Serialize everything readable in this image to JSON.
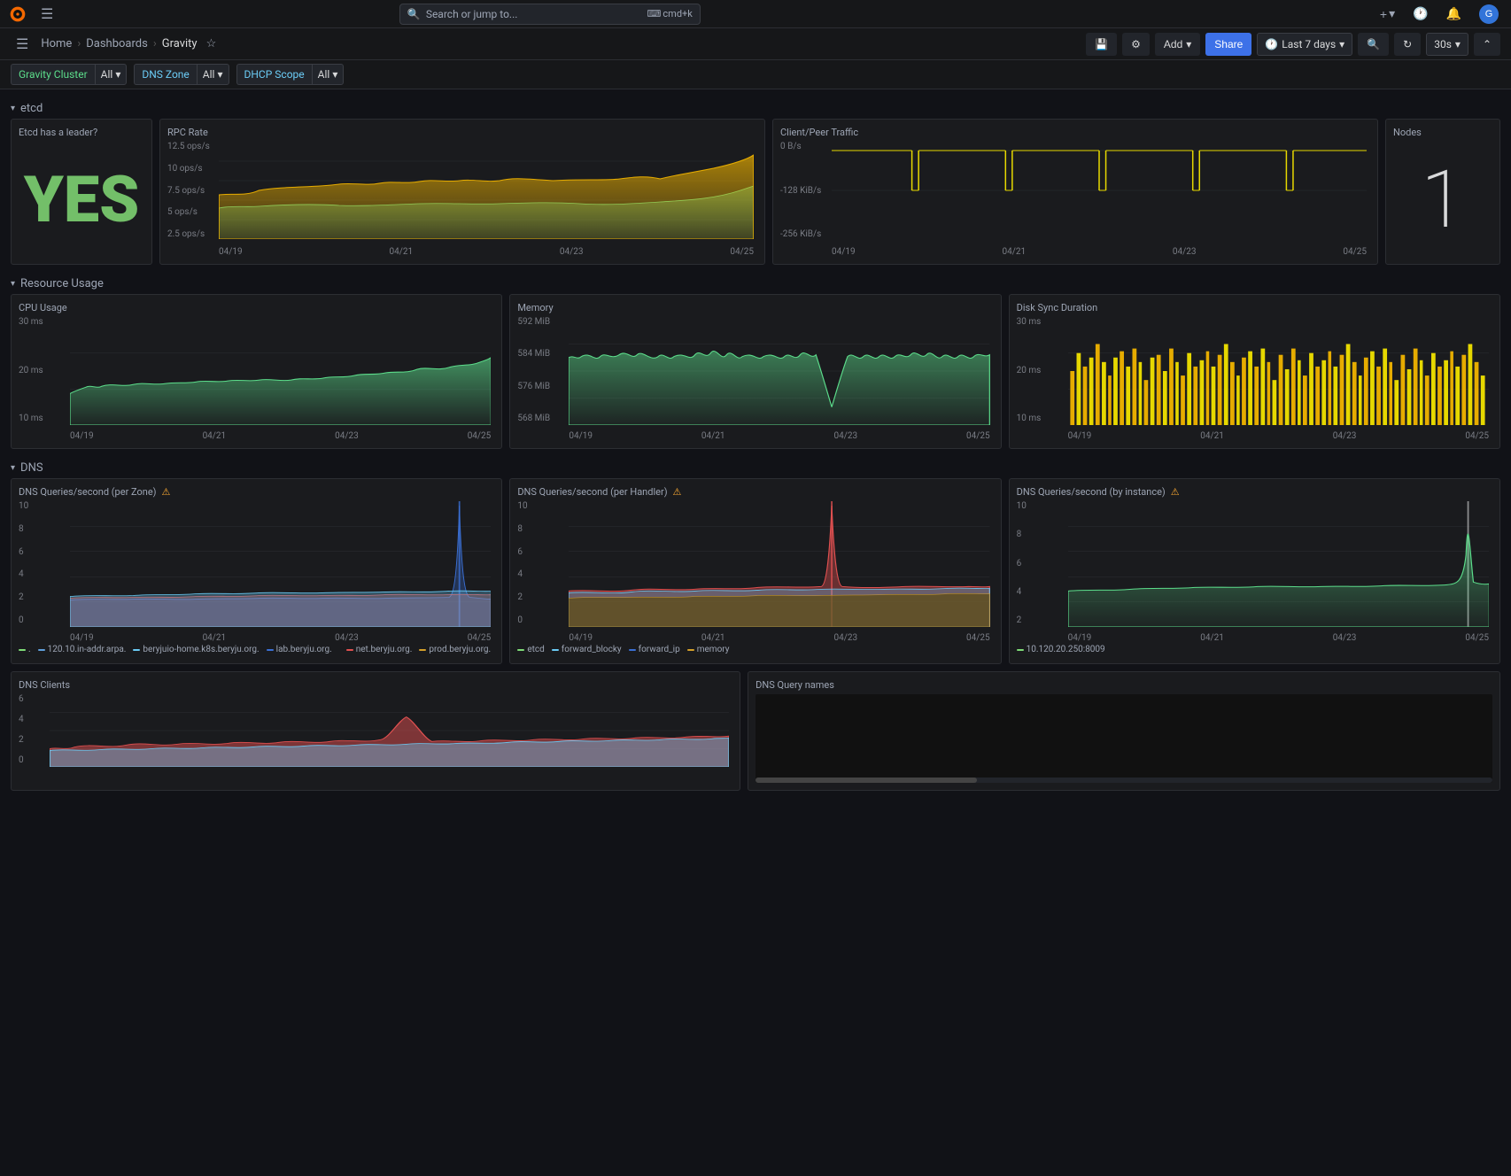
{
  "topbar": {
    "logo_title": "Grafana",
    "search_placeholder": "Search or jump to...",
    "search_shortcut": "cmd+k",
    "btn_plus": "+",
    "btn_clock": "🕐",
    "btn_bell": "🔔",
    "btn_avatar": "👤"
  },
  "breadcrumb": {
    "home": "Home",
    "dashboards": "Dashboards",
    "current": "Gravity",
    "save_label": "💾",
    "settings_label": "⚙",
    "add_label": "Add",
    "add_chevron": "▾",
    "share_label": "Share",
    "time_range": "Last 7 days",
    "time_chevron": "▾",
    "zoom_out": "🔍",
    "refresh": "↻",
    "interval": "30s",
    "interval_chevron": "▾",
    "collapse": "⌃"
  },
  "variables": {
    "gravity_cluster": {
      "label": "Gravity Cluster",
      "value": "All",
      "chevron": "▾"
    },
    "dns_zone": {
      "label": "DNS Zone",
      "value": "All",
      "chevron": "▾"
    },
    "dhcp_scope": {
      "label": "DHCP Scope",
      "value": "All",
      "chevron": "▾"
    }
  },
  "sections": {
    "etcd": {
      "label": "etcd",
      "collapsed": false,
      "chevron": "▾"
    },
    "resource_usage": {
      "label": "Resource Usage",
      "collapsed": false,
      "chevron": "▾"
    },
    "dns": {
      "label": "DNS",
      "collapsed": false,
      "chevron": "▾"
    }
  },
  "panels": {
    "etcd_has_leader": {
      "title": "Etcd has a leader?",
      "value": "YES"
    },
    "rpc_rate": {
      "title": "RPC Rate",
      "y_labels": [
        "12.5 ops/s",
        "10 ops/s",
        "7.5 ops/s",
        "5 ops/s",
        "2.5 ops/s"
      ],
      "x_labels": [
        "04/19",
        "04/21",
        "04/23",
        "04/25"
      ]
    },
    "client_peer_traffic": {
      "title": "Client/Peer Traffic",
      "y_labels": [
        "0 B/s",
        "-128 KiB/s",
        "-256 KiB/s"
      ],
      "x_labels": [
        "04/19",
        "04/21",
        "04/23",
        "04/25"
      ]
    },
    "nodes": {
      "title": "Nodes",
      "value": "1"
    },
    "cpu_usage": {
      "title": "CPU Usage",
      "y_labels": [
        "30 ms",
        "20 ms",
        "10 ms"
      ],
      "x_labels": [
        "04/19",
        "04/21",
        "04/23",
        "04/25"
      ]
    },
    "memory": {
      "title": "Memory",
      "y_labels": [
        "592 MiB",
        "584 MiB",
        "576 MiB",
        "568 MiB"
      ],
      "x_labels": [
        "04/19",
        "04/21",
        "04/23",
        "04/25"
      ]
    },
    "disk_sync": {
      "title": "Disk Sync Duration",
      "y_labels": [
        "30 ms",
        "20 ms",
        "10 ms"
      ],
      "x_labels": [
        "04/19",
        "04/21",
        "04/23",
        "04/25"
      ]
    },
    "dns_queries_zone": {
      "title": "DNS Queries/second (per Zone)",
      "alert": true,
      "y_labels": [
        "10",
        "8",
        "6",
        "4",
        "2",
        "0"
      ],
      "x_labels": [
        "04/19",
        "04/21",
        "04/23",
        "04/25"
      ],
      "legend": [
        {
          "color": "#7fdb78",
          "label": "."
        },
        {
          "color": "#5f9fdb",
          "label": "120.10.in-addr.arpa."
        },
        {
          "color": "#6bcbf5",
          "label": "beryjuio-home.k8s.beryju.org."
        },
        {
          "color": "#3a6fd4",
          "label": "lab.beryju.org."
        },
        {
          "color": "#e05050",
          "label": "net.beryju.org."
        },
        {
          "color": "#d4a02a",
          "label": "prod.beryju.org."
        }
      ]
    },
    "dns_queries_handler": {
      "title": "DNS Queries/second (per Handler)",
      "alert": true,
      "y_labels": [
        "10",
        "8",
        "6",
        "4",
        "2",
        "0"
      ],
      "x_labels": [
        "04/19",
        "04/21",
        "04/23",
        "04/25"
      ],
      "legend": [
        {
          "color": "#7fdb78",
          "label": "etcd"
        },
        {
          "color": "#6bcbf5",
          "label": "forward_blocky"
        },
        {
          "color": "#3a6fd4",
          "label": "forward_ip"
        },
        {
          "color": "#d4a02a",
          "label": "memory"
        }
      ]
    },
    "dns_queries_instance": {
      "title": "DNS Queries/second (by instance)",
      "alert": true,
      "y_labels": [
        "10",
        "8",
        "6",
        "4",
        "2"
      ],
      "x_labels": [
        "04/19",
        "04/21",
        "04/23",
        "04/25"
      ],
      "legend": [
        {
          "color": "#7fdb78",
          "label": "10.120.20.250:8009"
        }
      ]
    },
    "dns_clients": {
      "title": "DNS Clients",
      "y_labels": [
        "6",
        "4",
        "2",
        "0"
      ],
      "x_labels": []
    },
    "dns_query_names": {
      "title": "DNS Query names",
      "y_labels": [],
      "x_labels": []
    }
  }
}
